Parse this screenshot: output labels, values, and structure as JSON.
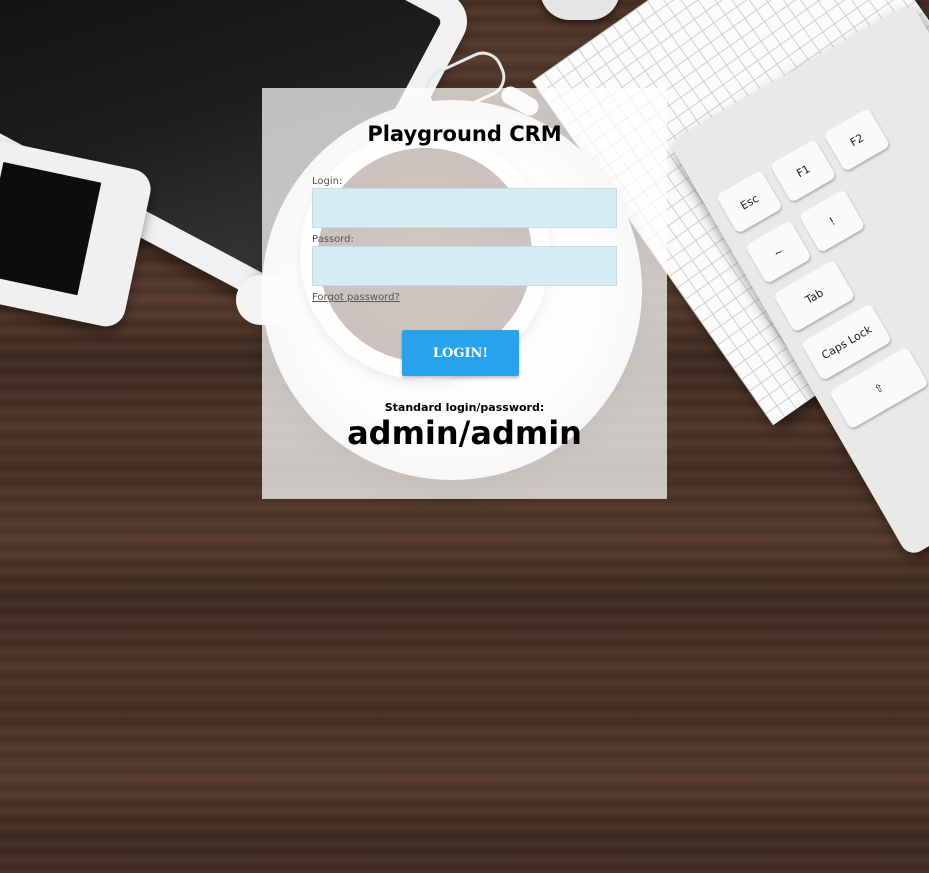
{
  "app": {
    "title": "Playground CRM"
  },
  "form": {
    "login_label": "Login:",
    "login_value": "",
    "password_label": "Passord:",
    "password_value": "",
    "forgot_link": "Forgot password?",
    "submit_label": "LOGIN!"
  },
  "hint": {
    "label": "Standard login/password:",
    "credentials": "admin/admin"
  },
  "colors": {
    "button": "#29a2ed",
    "field_bg": "#d5ecf2",
    "panel_overlay": "rgba(255,255,255,0.72)"
  },
  "keyboard": {
    "keys": [
      "Esc",
      "F1",
      "F2",
      "~",
      "!",
      "Tab",
      "Caps Lock",
      "⇧"
    ]
  }
}
